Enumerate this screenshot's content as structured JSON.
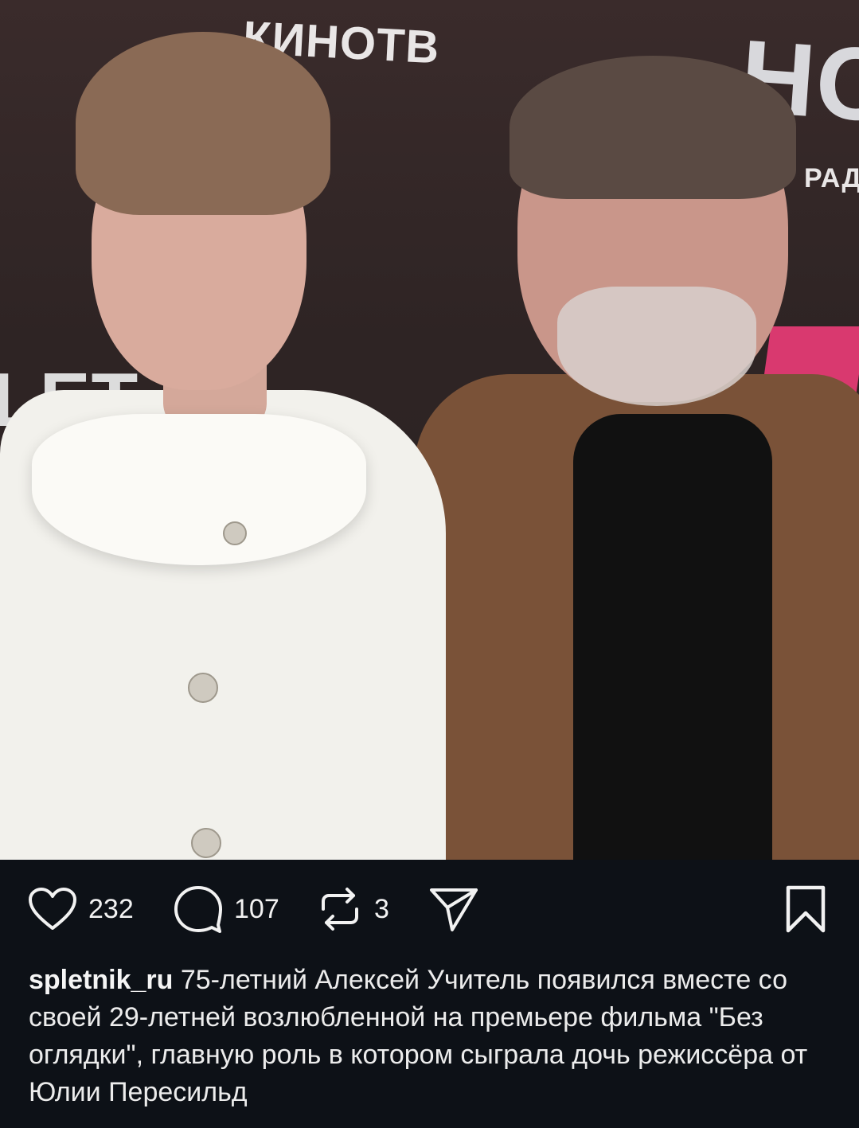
{
  "photo": {
    "backdrop_texts": [
      "КИНОТВ",
      "НОВ",
      "РАД",
      "LET"
    ]
  },
  "actions": {
    "likes": "232",
    "comments": "107",
    "reposts": "3"
  },
  "post": {
    "username": "spletnik_ru",
    "caption": "75-летний Алексей Учитель появился вместе со своей 29-летней возлюбленной на премьере фильма \"Без оглядки\", главную роль в котором сыграла дочь режиссёра от Юлии Пересильд"
  }
}
